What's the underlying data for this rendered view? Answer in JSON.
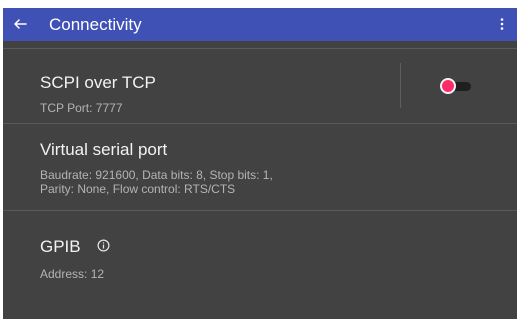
{
  "appbar": {
    "title": "Connectivity",
    "back_icon": "arrow-left-icon",
    "menu_icon": "more-vert-icon",
    "color": "#3f51b5"
  },
  "items": [
    {
      "title": "SCPI over TCP",
      "subtitle": "TCP Port: 7777",
      "switch": {
        "on": true,
        "thumb_color": "#ff2a68"
      }
    },
    {
      "title": "Virtual serial port",
      "subtitle_line1": "Baudrate: 921600, Data bits: 8, Stop bits: 1,",
      "subtitle_line2": "Parity: None, Flow control: RTS/CTS"
    },
    {
      "title": "GPIB",
      "subtitle": "Address: 12",
      "icon": "info-icon"
    }
  ],
  "colors": {
    "background": "#424242",
    "title_text": "#f2f2f2",
    "subtitle_text": "#b4b4b4",
    "divider": "#5a5a5a"
  }
}
